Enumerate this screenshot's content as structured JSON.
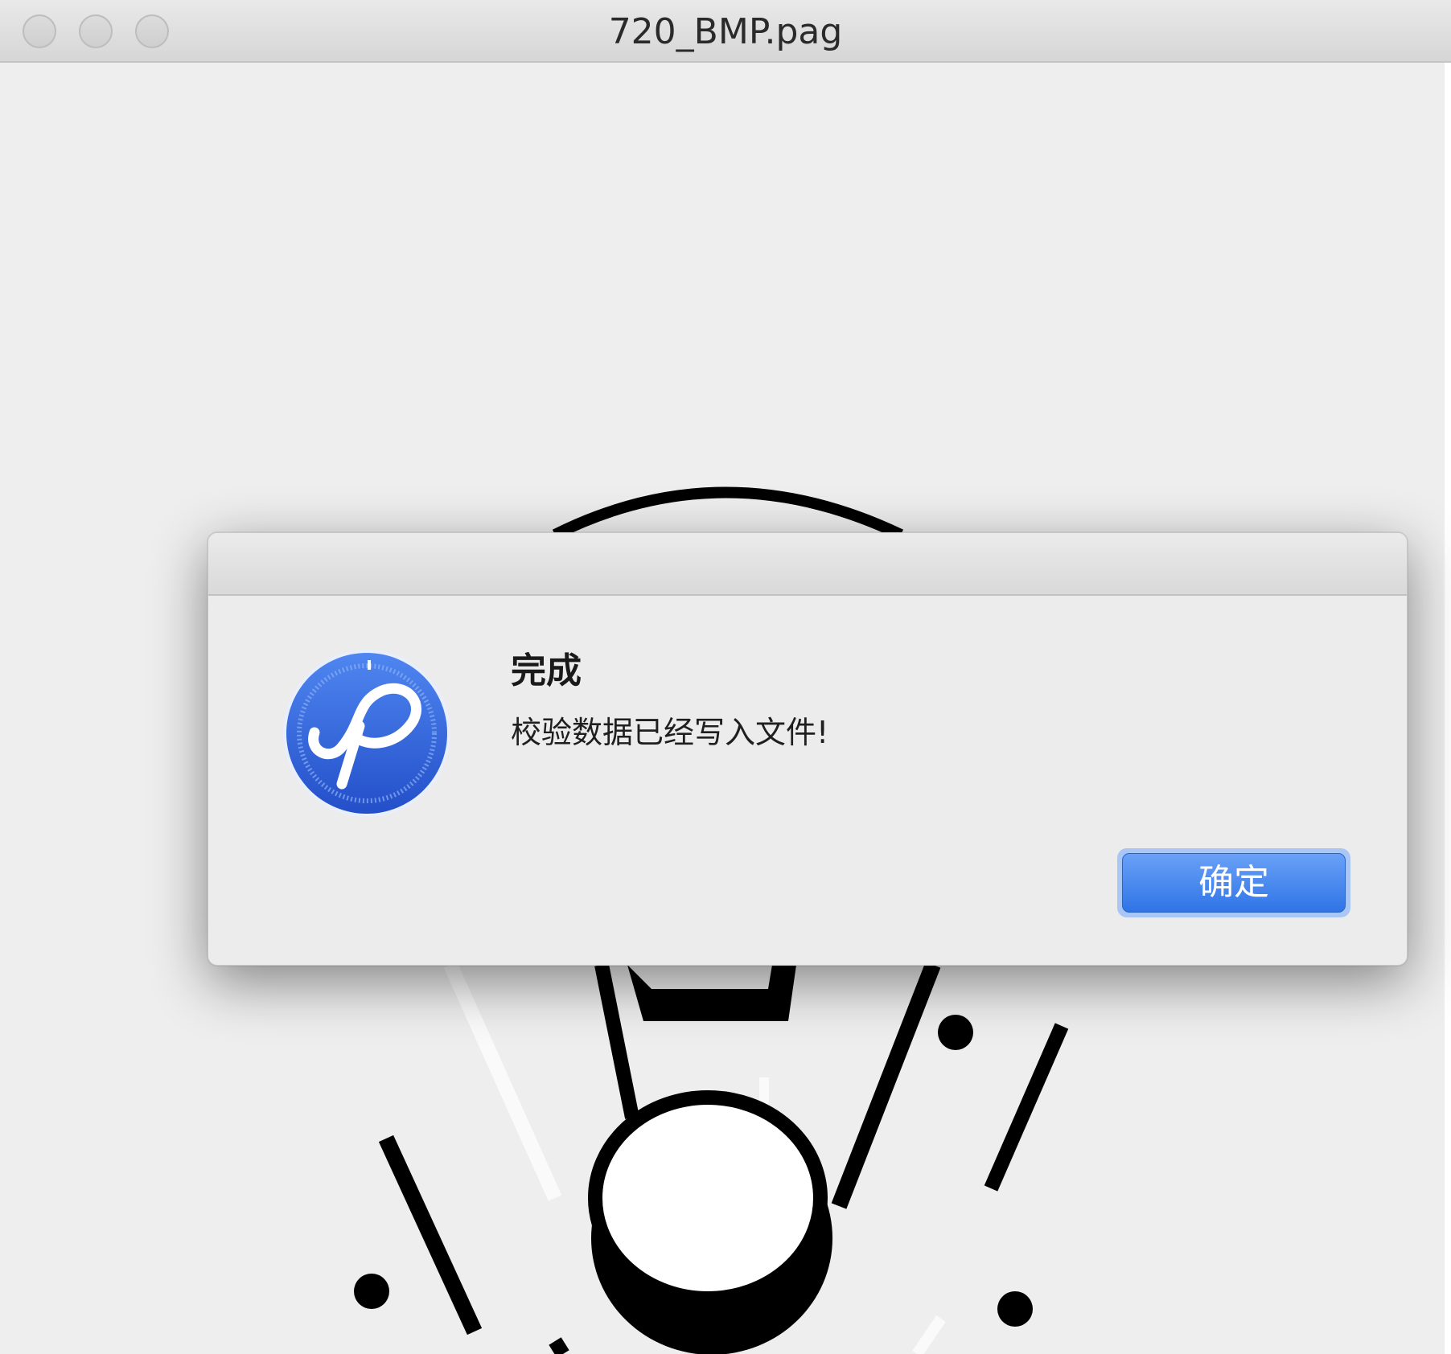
{
  "window": {
    "title": "720_BMP.pag"
  },
  "dialog": {
    "title": "完成",
    "message": "校验数据已经写入文件!",
    "ok_label": "确定"
  },
  "colors": {
    "accent": "#2f74e6",
    "icon_blue": "#2f63d8"
  },
  "icons": {
    "app": "pag-viewer-app-icon"
  }
}
